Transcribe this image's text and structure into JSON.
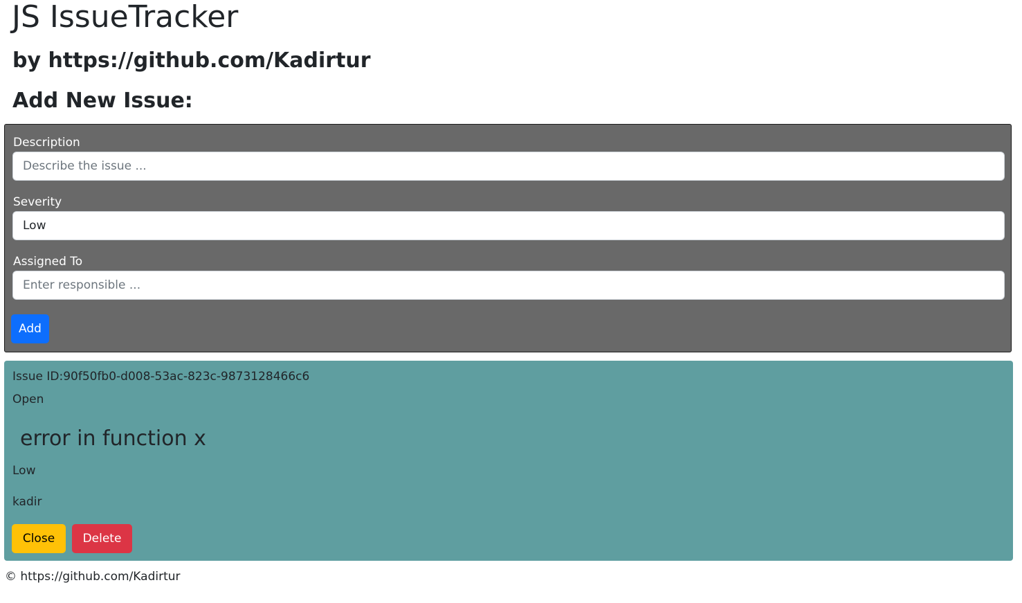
{
  "header": {
    "title": "JS IssueTracker",
    "byline": "by https://github.com/Kadirtur",
    "add_heading": "Add New Issue:"
  },
  "form": {
    "description_label": "Description",
    "description_placeholder": "Describe the issue ...",
    "description_value": "",
    "severity_label": "Severity",
    "severity_value": "Low",
    "assigned_label": "Assigned To",
    "assigned_placeholder": "Enter responsible ...",
    "assigned_value": "",
    "add_label": "Add",
    "panel_color": "#696969"
  },
  "issues": [
    {
      "id_text": "Issue ID:90f50fb0-d008-53ac-823c-9873128466c6",
      "status": "Open",
      "description": "error in function x",
      "severity": "Low",
      "assigned_to": "kadir",
      "close_label": "Close",
      "delete_label": "Delete",
      "card_color": "#5f9ea0"
    }
  ],
  "footer": {
    "copyright": "© https://github.com/Kadirtur"
  },
  "colors": {
    "primary": "#0d6efd",
    "warning": "#ffc107",
    "danger": "#dc3545"
  }
}
